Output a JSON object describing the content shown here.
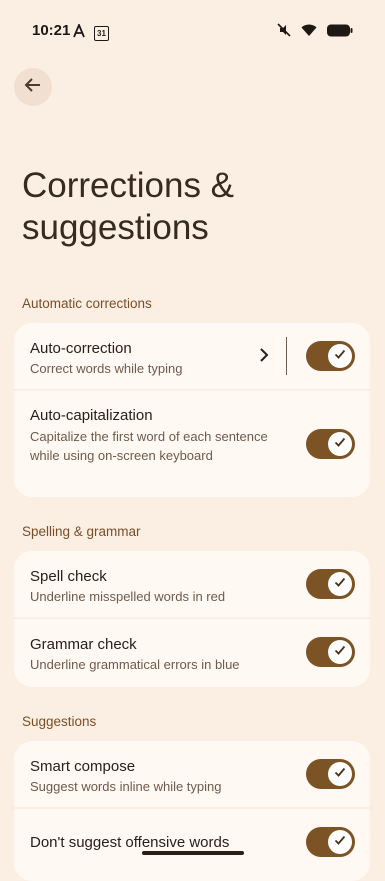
{
  "status": {
    "time": "10:21",
    "icons_left": [
      "font-a-icon",
      "calendar-31-icon"
    ],
    "calendar_day": "31",
    "icons_right": [
      "silent-icon",
      "wifi-icon",
      "battery-icon"
    ]
  },
  "nav": {
    "back_icon": "arrow-left-icon"
  },
  "page": {
    "title_line1": "Corrections &",
    "title_line2": "suggestions"
  },
  "sections": [
    {
      "header": "Automatic corrections",
      "rows": [
        {
          "title": "Auto-correction",
          "subtitle": "Correct words while typing",
          "toggle": true,
          "has_chevron": true
        },
        {
          "title": "Auto-capitalization",
          "subtitle": "Capitalize the first word of each sentence while using on-screen keyboard",
          "toggle": true
        }
      ]
    },
    {
      "header": "Spelling & grammar",
      "rows": [
        {
          "title": "Spell check",
          "subtitle": "Underline misspelled words in red",
          "toggle": true
        },
        {
          "title": "Grammar check",
          "subtitle": "Underline grammatical errors in blue",
          "toggle": true
        }
      ]
    },
    {
      "header": "Suggestions",
      "rows": [
        {
          "title": "Smart compose",
          "subtitle": "Suggest words inline while typing",
          "toggle": true
        },
        {
          "title": "Don't suggest offensive words",
          "toggle": true
        }
      ]
    }
  ],
  "colors": {
    "background": "#fbeee3",
    "card": "#fff8f3",
    "toggle_on": "#7b5324",
    "section_header": "#7a4f27"
  }
}
